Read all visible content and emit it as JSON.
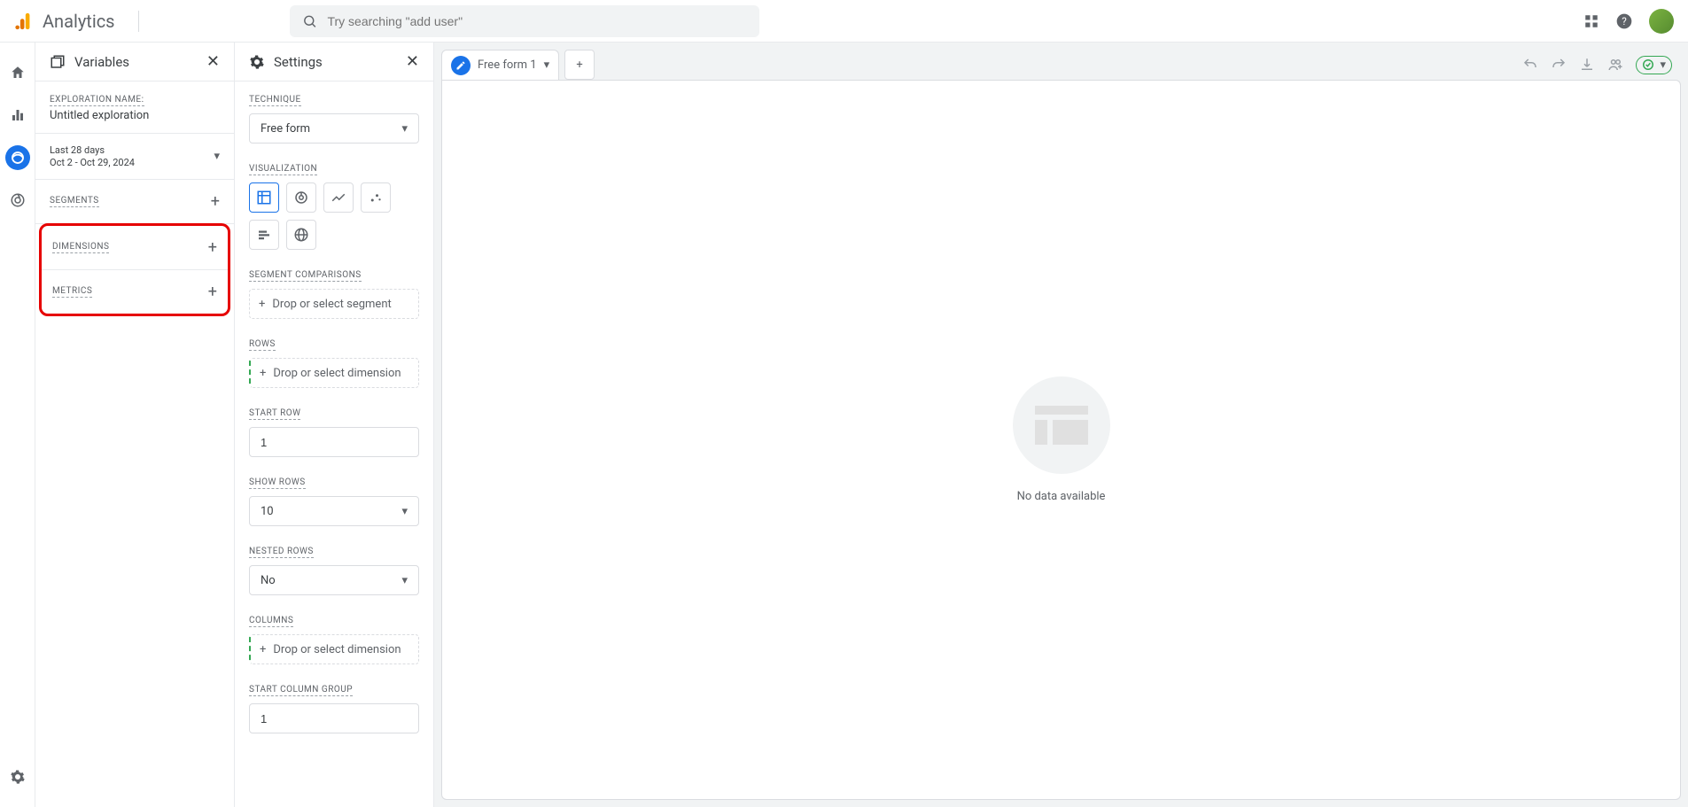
{
  "header": {
    "app_name": "Analytics",
    "search_placeholder": "Try searching \"add user\""
  },
  "variables_panel": {
    "title": "Variables",
    "exploration_name_label": "EXPLORATION NAME:",
    "exploration_name_value": "Untitled exploration",
    "date_preset": "Last 28 days",
    "date_range": "Oct 2 - Oct 29, 2024",
    "segments_label": "SEGMENTS",
    "dimensions_label": "DIMENSIONS",
    "metrics_label": "METRICS"
  },
  "settings_panel": {
    "title": "Settings",
    "technique_label": "TECHNIQUE",
    "technique_value": "Free form",
    "visualization_label": "VISUALIZATION",
    "segment_comparisons_label": "SEGMENT COMPARISONS",
    "segment_drop": "Drop or select segment",
    "rows_label": "ROWS",
    "rows_drop": "Drop or select dimension",
    "start_row_label": "START ROW",
    "start_row_value": "1",
    "show_rows_label": "SHOW ROWS",
    "show_rows_value": "10",
    "nested_rows_label": "NESTED ROWS",
    "nested_rows_value": "No",
    "columns_label": "COLUMNS",
    "columns_drop": "Drop or select dimension",
    "start_column_group_label": "START COLUMN GROUP",
    "start_column_value": "1"
  },
  "canvas": {
    "tab_name": "Free form 1",
    "no_data": "No data available"
  }
}
